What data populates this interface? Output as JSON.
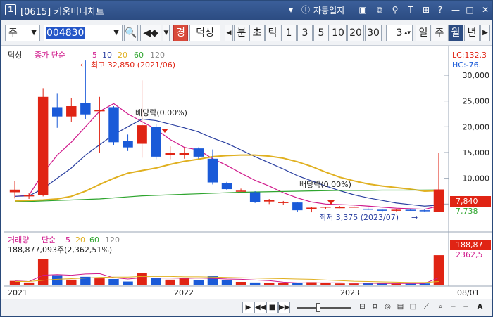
{
  "window": {
    "number": "1",
    "title": "[0615] 키움미니차트",
    "autolock_label": "자동일지"
  },
  "toolbar": {
    "period_select": "주",
    "stock_code": "004830",
    "stock_name": "덕성",
    "badge": "경",
    "interval_labels": [
      "분",
      "초",
      "틱"
    ],
    "numbers": [
      "1",
      "3",
      "5",
      "10",
      "20",
      "30"
    ],
    "count_value": "3",
    "period_buttons": [
      "일",
      "주",
      "월",
      "년"
    ],
    "selected_period": "월"
  },
  "price_panel": {
    "legend_name": "덕성",
    "legend_ma": "종가 단순",
    "ma_periods": [
      "5",
      "10",
      "20",
      "60",
      "120"
    ],
    "ma_colors": [
      "#d01a8c",
      "#2a3fa0",
      "#e0b020",
      "#2ea52e",
      "#888888"
    ],
    "lc_label": "LC:132.3",
    "hc_label": "HC:-76.",
    "high_annotation": "최고 32,850 (2021/06)",
    "low_annotation": "최저 3,375 (2023/07)",
    "dividend_labels": [
      "배당락(0.00%)",
      "배당락(0.00%)"
    ],
    "price_axis_ticks": [
      "30,000",
      "25,000",
      "20,000",
      "15,000",
      "10,000",
      "5,000"
    ],
    "current_price_tag": "7,840",
    "ma_tag": "7,738"
  },
  "volume_panel": {
    "legend_name": "거래량",
    "legend_ma": "단순",
    "ma_periods": [
      "5",
      "20",
      "60",
      "120"
    ],
    "volume_info": "188,877,093주(2,362,51%)",
    "axis_tag_top": "188,87",
    "axis_tag_bottom": "2362,5"
  },
  "x_axis": {
    "labels": [
      "2021",
      "2022",
      "2023"
    ],
    "last_date": "08/01"
  },
  "colors": {
    "up": "#e02414",
    "down": "#1a5ad8",
    "accent": "#2c4c82"
  },
  "chart_data": {
    "type": "candlestick",
    "title": "덕성",
    "interval": "monthly",
    "y_unit": "KRW",
    "ylim": [
      0,
      33000
    ],
    "y_ticks": [
      5000,
      10000,
      15000,
      20000,
      25000,
      30000
    ],
    "x_labels": [
      "2021",
      "2022",
      "2023"
    ],
    "candles": [
      {
        "o": 7300,
        "h": 9500,
        "l": 6100,
        "c": 7800
      },
      {
        "o": 6600,
        "h": 7200,
        "l": 6000,
        "c": 6700
      },
      {
        "o": 6700,
        "h": 27500,
        "l": 6500,
        "c": 25800
      },
      {
        "o": 23800,
        "h": 26400,
        "l": 19800,
        "c": 22000
      },
      {
        "o": 22000,
        "h": 25600,
        "l": 20900,
        "c": 24000
      },
      {
        "o": 24600,
        "h": 32850,
        "l": 21500,
        "c": 22400
      },
      {
        "o": 23000,
        "h": 25800,
        "l": 15000,
        "c": 23300
      },
      {
        "o": 23800,
        "h": 24000,
        "l": 16500,
        "c": 17000
      },
      {
        "o": 17200,
        "h": 18500,
        "l": 15300,
        "c": 16000
      },
      {
        "o": 16700,
        "h": 29000,
        "l": 14000,
        "c": 20300
      },
      {
        "o": 20000,
        "h": 20500,
        "l": 13700,
        "c": 14200
      },
      {
        "o": 14500,
        "h": 16200,
        "l": 13700,
        "c": 15000
      },
      {
        "o": 14500,
        "h": 16000,
        "l": 13800,
        "c": 15000
      },
      {
        "o": 15800,
        "h": 16000,
        "l": 13800,
        "c": 14200
      },
      {
        "o": 13800,
        "h": 15600,
        "l": 8800,
        "c": 9200
      },
      {
        "o": 9100,
        "h": 9300,
        "l": 7700,
        "c": 7900
      },
      {
        "o": 7600,
        "h": 8000,
        "l": 7500,
        "c": 7600
      },
      {
        "o": 7300,
        "h": 7500,
        "l": 5200,
        "c": 5400
      },
      {
        "o": 5500,
        "h": 6000,
        "l": 5000,
        "c": 5800
      },
      {
        "o": 5200,
        "h": 5600,
        "l": 4800,
        "c": 5400
      },
      {
        "o": 5300,
        "h": 5400,
        "l": 3500,
        "c": 3800
      },
      {
        "o": 4000,
        "h": 4500,
        "l": 3400,
        "c": 4300
      },
      {
        "o": 4300,
        "h": 4500,
        "l": 4100,
        "c": 4500
      },
      {
        "o": 4400,
        "h": 4600,
        "l": 4200,
        "c": 4400
      },
      {
        "o": 4500,
        "h": 4600,
        "l": 4300,
        "c": 4500
      },
      {
        "o": 4100,
        "h": 4300,
        "l": 3800,
        "c": 3900
      },
      {
        "o": 3900,
        "h": 4100,
        "l": 3375,
        "c": 3700
      },
      {
        "o": 3800,
        "h": 4000,
        "l": 3600,
        "c": 3900
      },
      {
        "o": 3900,
        "h": 4100,
        "l": 3700,
        "c": 3800
      },
      {
        "o": 3800,
        "h": 4000,
        "l": 3500,
        "c": 3600
      },
      {
        "o": 3500,
        "h": 15000,
        "l": 3500,
        "c": 7840
      }
    ],
    "ma_series": [
      {
        "name": "5",
        "values": [
          6500,
          6700,
          11000,
          14500,
          17000,
          20000,
          23000,
          24500,
          22500,
          21000,
          19500,
          17500,
          16000,
          15500,
          13800,
          12500,
          11000,
          9600,
          8500,
          7200,
          6200,
          5400,
          5000,
          4900,
          4800,
          4600,
          4400,
          4200,
          4100,
          4000,
          4600
        ]
      },
      {
        "name": "10",
        "values": [
          6500,
          6600,
          8000,
          10000,
          12000,
          14500,
          16500,
          18500,
          20000,
          21500,
          21200,
          20500,
          19800,
          19000,
          17800,
          16800,
          15500,
          14200,
          13000,
          11800,
          10500,
          9500,
          8500,
          7600,
          6800,
          6200,
          5700,
          5200,
          4900,
          4600,
          4800
        ]
      },
      {
        "name": "20",
        "values": [
          5600,
          5700,
          5800,
          6000,
          6500,
          7500,
          8800,
          10000,
          11000,
          11500,
          12000,
          12700,
          13300,
          13700,
          14200,
          14400,
          14500,
          14500,
          14300,
          13900,
          13200,
          12300,
          11200,
          10200,
          9500,
          8900,
          8500,
          8200,
          7900,
          7500,
          7600
        ]
      },
      {
        "name": "60",
        "values": [
          5400,
          5500,
          5600,
          5700,
          5800,
          5900,
          6000,
          6200,
          6400,
          6600,
          6700,
          6800,
          6900,
          7000,
          7100,
          7200,
          7300,
          7350,
          7400,
          7450,
          7500,
          7550,
          7600,
          7650,
          7650,
          7650,
          7700,
          7700,
          7700,
          7720,
          7738
        ]
      }
    ],
    "volume": [
      12,
      7,
      82,
      30,
      16,
      25,
      20,
      18,
      10,
      38,
      21,
      16,
      20,
      14,
      28,
      15,
      9,
      7,
      6,
      5,
      5,
      8,
      5,
      4,
      4,
      5,
      4,
      3,
      3,
      4,
      94
    ],
    "volume_ma_series": [
      {
        "name": "5",
        "values": [
          12,
          10,
          30,
          32,
          30,
          34,
          35,
          22,
          18,
          22,
          21,
          21,
          20,
          21,
          20,
          18,
          17,
          15,
          13,
          8,
          6,
          6,
          6,
          6,
          5,
          5,
          4,
          4,
          4,
          4,
          22
        ]
      },
      {
        "name": "20",
        "values": [
          10,
          10,
          14,
          17,
          19,
          21,
          23,
          24,
          24,
          26,
          26,
          26,
          25,
          25,
          24,
          23,
          22,
          21,
          20,
          19,
          18,
          17,
          15,
          13,
          11,
          10,
          9,
          8,
          7,
          7,
          10
        ]
      }
    ]
  }
}
